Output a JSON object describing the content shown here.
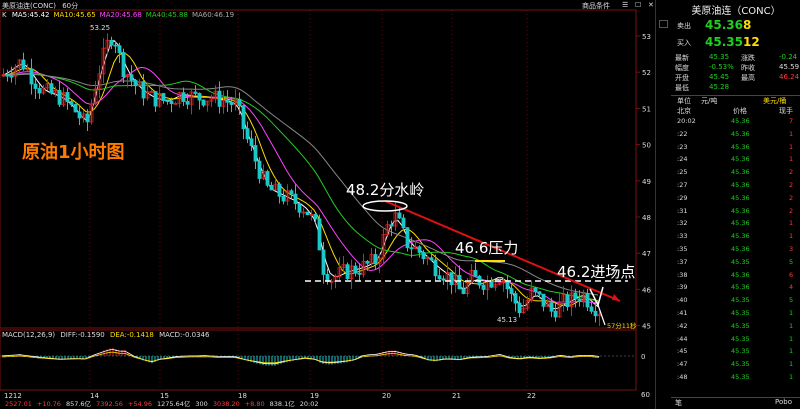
{
  "header": {
    "instrument": "美原油连(CONC)",
    "period": "60分",
    "ma_labels": [
      {
        "text": "MA5:45.42",
        "color": "#ffffff"
      },
      {
        "text": "MA10:45.65",
        "color": "#ffdd00"
      },
      {
        "text": "MA20:45.68",
        "color": "#ff44ff"
      },
      {
        "text": "MA40:45.88",
        "color": "#22cc22"
      },
      {
        "text": "MA60:46.19",
        "color": "#aaaaaa"
      }
    ],
    "k_label": "K",
    "tabs": [
      "商品条件",
      "☰",
      "☐",
      "✕"
    ]
  },
  "price_axis": [
    "53",
    "52",
    "51",
    "50",
    "49",
    "48",
    "47",
    "46",
    "45"
  ],
  "date_axis": [
    "1212",
    "14",
    "15",
    "18",
    "19",
    "20",
    "21",
    "22"
  ],
  "date_axis_right": "60分",
  "chart_marks": {
    "high_label": "53.25",
    "low_label": "45.13",
    "last_label": "57分11秒"
  },
  "annotations": {
    "title": "原油1小时图",
    "watershed": "48.2分水岭",
    "pressure": "46.6压力",
    "entry": "46.2进场点"
  },
  "macd": {
    "label": "MACD(12,26,9)",
    "diff": "DIFF:-0.1590",
    "dea": "DEA:-0.1418",
    "macd": "MACD:-0.0346",
    "zero": "0"
  },
  "quote": {
    "title": "美原油连（CONC）",
    "sell_label": "卖出",
    "sell_price": "45.36",
    "sell_qty": "8",
    "buy_label": "买入",
    "buy_price": "45.35",
    "buy_qty": "12",
    "stats": [
      {
        "l1": "最新",
        "v1": "45.35",
        "l2": "涨跌",
        "v2": "-0.24"
      },
      {
        "l1": "幅度",
        "v1": "-0.53%",
        "l2": "昨收",
        "v2": "45.59"
      },
      {
        "l1": "开盘",
        "v1": "45.45",
        "l2": "最高",
        "v2": "46.24"
      },
      {
        "l1": "最低",
        "v1": "45.28",
        "l2": "",
        "v2": ""
      }
    ],
    "unit_label": "单位",
    "unit_value": "元/吨",
    "currency": "美元/桶",
    "col_time": "北京",
    "col_price": "价格",
    "col_qty": "现手",
    "trades": [
      {
        "t": "20:02",
        "p": "45.36",
        "q": "7",
        "c": "red"
      },
      {
        "t": ":22",
        "p": "45.36",
        "q": "1",
        "c": "red"
      },
      {
        "t": ":23",
        "p": "45.36",
        "q": "1",
        "c": "red"
      },
      {
        "t": ":24",
        "p": "45.36",
        "q": "1",
        "c": "red"
      },
      {
        "t": ":25",
        "p": "45.36",
        "q": "2",
        "c": "red"
      },
      {
        "t": ":27",
        "p": "45.36",
        "q": "2",
        "c": "red"
      },
      {
        "t": ":29",
        "p": "45.36",
        "q": "2",
        "c": "red"
      },
      {
        "t": ":31",
        "p": "45.36",
        "q": "2",
        "c": "red"
      },
      {
        "t": ":32",
        "p": "45.36",
        "q": "1",
        "c": "red"
      },
      {
        "t": ":33",
        "p": "45.36",
        "q": "1",
        "c": "red"
      },
      {
        "t": ":35",
        "p": "45.36",
        "q": "3",
        "c": "red"
      },
      {
        "t": ":37",
        "p": "45.35",
        "q": "5",
        "c": "green"
      },
      {
        "t": ":38",
        "p": "45.36",
        "q": "6",
        "c": "red"
      },
      {
        "t": ":39",
        "p": "45.36",
        "q": "4",
        "c": "red"
      },
      {
        "t": ":40",
        "p": "45.35",
        "q": "5",
        "c": "green"
      },
      {
        "t": ":41",
        "p": "45.35",
        "q": "1",
        "c": "green"
      },
      {
        "t": ":42",
        "p": "45.35",
        "q": "1",
        "c": "green"
      },
      {
        "t": ":44",
        "p": "45.35",
        "q": "1",
        "c": "green"
      },
      {
        "t": ":45",
        "p": "45.35",
        "q": "1",
        "c": "green"
      },
      {
        "t": ":47",
        "p": "45.35",
        "q": "1",
        "c": "green"
      },
      {
        "t": ":48",
        "p": "45.35",
        "q": "1",
        "c": "green"
      }
    ],
    "bottom_left": "笔",
    "bottom_right": "Pobo"
  },
  "status_bar": [
    {
      "text": "2527.01",
      "color": "#ff3b3b"
    },
    {
      "text": "+10.76",
      "color": "#ff3b3b"
    },
    {
      "text": "857.6亿",
      "color": "#ddd"
    },
    {
      "text": "7392.56",
      "color": "#ff3b3b"
    },
    {
      "text": "+54.96",
      "color": "#ff3b3b"
    },
    {
      "text": "1275.64亿",
      "color": "#ddd"
    },
    {
      "text": "300",
      "color": "#ddd"
    },
    {
      "text": "3038.20",
      "color": "#ff3b3b"
    },
    {
      "text": "+8.80",
      "color": "#ff3b3b"
    },
    {
      "text": "838.1亿",
      "color": "#ddd"
    },
    {
      "text": "20:02",
      "color": "#ddd"
    }
  ]
}
